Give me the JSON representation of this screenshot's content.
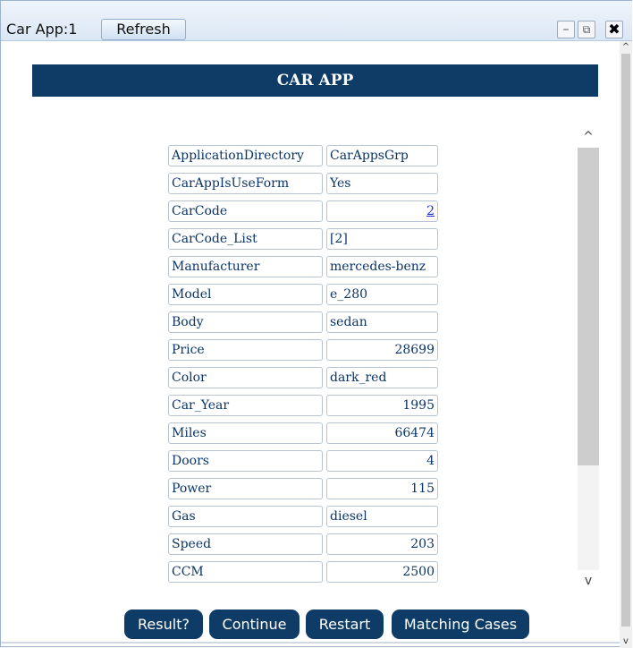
{
  "window": {
    "title": "Car App:1",
    "refresh_label": "Refresh",
    "controls": {
      "minimize": "–",
      "popout": "⧉",
      "close": "✖"
    }
  },
  "header": {
    "title": "CAR APP"
  },
  "fields": [
    {
      "key": "ApplicationDirectory",
      "value": "CarAppsGrp",
      "numeric": false
    },
    {
      "key": "CarAppIsUseForm",
      "value": "Yes",
      "numeric": false
    },
    {
      "key": "CarCode",
      "value": "2",
      "numeric": true,
      "link": true
    },
    {
      "key": "CarCode_List",
      "value": "[2]",
      "numeric": false
    },
    {
      "key": "Manufacturer",
      "value": "mercedes-benz",
      "numeric": false
    },
    {
      "key": "Model",
      "value": "e_280",
      "numeric": false
    },
    {
      "key": "Body",
      "value": "sedan",
      "numeric": false
    },
    {
      "key": "Price",
      "value": "28699",
      "numeric": true
    },
    {
      "key": "Color",
      "value": "dark_red",
      "numeric": false
    },
    {
      "key": "Car_Year",
      "value": "1995",
      "numeric": true
    },
    {
      "key": "Miles",
      "value": "66474",
      "numeric": true
    },
    {
      "key": "Doors",
      "value": "4",
      "numeric": true
    },
    {
      "key": "Power",
      "value": "115",
      "numeric": true
    },
    {
      "key": "Gas",
      "value": "diesel",
      "numeric": false
    },
    {
      "key": "Speed",
      "value": "203",
      "numeric": true
    },
    {
      "key": "CCM",
      "value": "2500",
      "numeric": true
    }
  ],
  "actions": [
    {
      "label": "Result?"
    },
    {
      "label": "Continue"
    },
    {
      "label": "Restart"
    },
    {
      "label": "Matching Cases"
    }
  ],
  "colors": {
    "header_bg": "#0f3c66",
    "field_text": "#0b3467",
    "link": "#1a2ad6"
  }
}
